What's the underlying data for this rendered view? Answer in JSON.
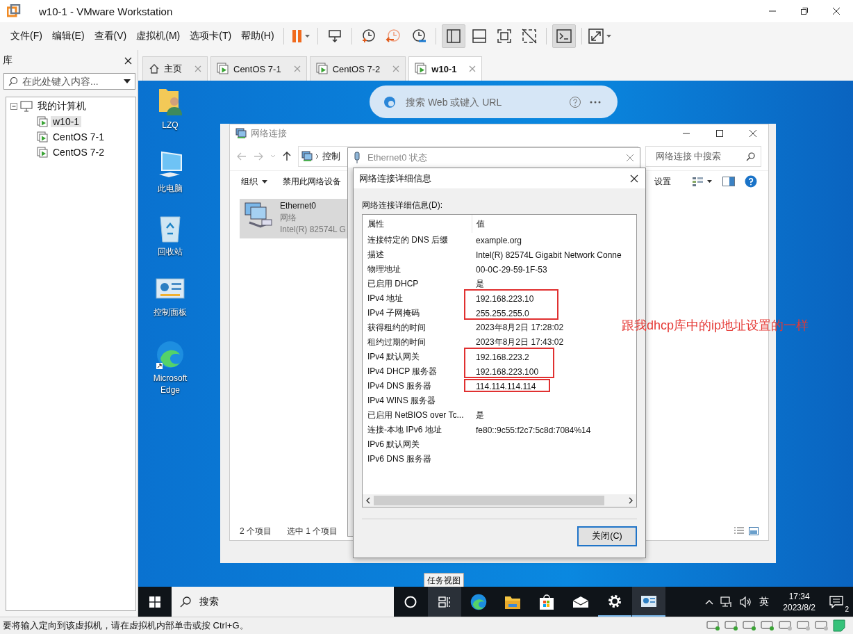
{
  "window": {
    "title": "w10-1 - VMware Workstation"
  },
  "menu": [
    "文件(F)",
    "编辑(E)",
    "查看(V)",
    "虚拟机(M)",
    "选项卡(T)",
    "帮助(H)"
  ],
  "toolbar": [
    {
      "kind": "pause",
      "pressed": false
    },
    {
      "kind": "send-keys",
      "pressed": false
    },
    {
      "kind": "snapshot-take",
      "pressed": false
    },
    {
      "kind": "snapshot-revert",
      "pressed": false
    },
    {
      "kind": "snapshot-manage",
      "pressed": false
    },
    {
      "kind": "view-library",
      "pressed": true
    },
    {
      "kind": "view-thumbs",
      "pressed": false
    },
    {
      "kind": "view-full",
      "pressed": false
    },
    {
      "kind": "view-unity",
      "pressed": false
    },
    {
      "kind": "console",
      "pressed": true
    },
    {
      "kind": "stretch",
      "pressed": false
    }
  ],
  "library": {
    "title": "库",
    "search": {
      "placeholder": "在此处键入内容..."
    },
    "tree": [
      {
        "label": "我的计算机",
        "expanded": true,
        "children": [
          {
            "label": "w10-1",
            "selected": true
          },
          {
            "label": "CentOS 7-1",
            "selected": false
          },
          {
            "label": "CentOS 7-2",
            "selected": false
          }
        ]
      }
    ]
  },
  "tabs": [
    {
      "label": "主页",
      "kind": "home",
      "selected": false
    },
    {
      "label": "CentOS 7-1",
      "kind": "vm",
      "selected": false
    },
    {
      "label": "CentOS 7-2",
      "kind": "vm",
      "selected": false
    },
    {
      "label": "w10-1",
      "kind": "vm",
      "selected": true
    }
  ],
  "desktop": {
    "icons": [
      {
        "label": "LZQ",
        "kind": "user"
      },
      {
        "label": "此电脑",
        "kind": "computer"
      },
      {
        "label": "回收站",
        "kind": "recycle"
      },
      {
        "label": "控制面板",
        "kind": "control"
      },
      {
        "label": "Microsoft Edge",
        "kind": "edge"
      }
    ],
    "edge_bar": {
      "placeholder": "搜索 Web 或键入 URL"
    },
    "annotation": "跟我dhcp库中的ip地址设置的一样",
    "tooltip": "任务视图"
  },
  "explorer": {
    "title": "网络连接",
    "address": "控制",
    "search_placeholder": "网络连接 中搜索",
    "commands": [
      {
        "label": "组织",
        "dropdown": true
      },
      {
        "label": "禁用此网络设备",
        "dropdown": false
      },
      {
        "label": "设置",
        "dropdown": false
      }
    ],
    "item": {
      "name": "Ethernet0",
      "lines": [
        "网络",
        "Intel(R) 82574L G"
      ],
      "selected": true
    },
    "status": [
      "2 个项目",
      "选中 1 个项目"
    ]
  },
  "status_dialog": {
    "title": "Ethernet0 状态"
  },
  "details_dialog": {
    "title": "网络连接详细信息",
    "label": "网络连接详细信息(D):",
    "columns": [
      "属性",
      "值"
    ],
    "row_groups": [
      {
        "boxed": false,
        "rows": [
          {
            "property": "连接特定的 DNS 后缀",
            "value": "example.org"
          },
          {
            "property": "描述",
            "value": "Intel(R) 82574L Gigabit Network Conne"
          },
          {
            "property": "物理地址",
            "value": "00-0C-29-59-1F-53"
          },
          {
            "property": "已启用 DHCP",
            "value": "是"
          }
        ]
      },
      {
        "boxed": true,
        "rows": [
          {
            "property": "IPv4 地址",
            "value": "192.168.223.10"
          },
          {
            "property": "IPv4 子网掩码",
            "value": "255.255.255.0"
          }
        ]
      },
      {
        "boxed": false,
        "rows": [
          {
            "property": "获得租约的时间",
            "value": "2023年8月2日 17:28:02"
          },
          {
            "property": "租约过期的时间",
            "value": "2023年8月2日 17:43:02"
          }
        ]
      },
      {
        "boxed": true,
        "rows": [
          {
            "property": "IPv4 默认网关",
            "value": "192.168.223.2"
          },
          {
            "property": "IPv4 DHCP 服务器",
            "value": "192.168.223.100"
          }
        ]
      },
      {
        "boxed": true,
        "rows": [
          {
            "property": "IPv4 DNS 服务器",
            "value": "114.114.114.114"
          }
        ]
      },
      {
        "boxed": false,
        "rows": [
          {
            "property": "IPv4 WINS 服务器",
            "value": ""
          },
          {
            "property": "已启用 NetBIOS over Tc...",
            "value": "是"
          },
          {
            "property": "连接-本地 IPv6 地址",
            "value": "fe80::9c55:f2c7:5c8d:7084%14"
          },
          {
            "property": "IPv6 默认网关",
            "value": ""
          },
          {
            "property": "IPv6 DNS 服务器",
            "value": ""
          }
        ]
      }
    ],
    "button": "关闭(C)"
  },
  "taskbar": {
    "search": "搜索",
    "apps": [
      {
        "kind": "cortana",
        "running": false,
        "hovered": false
      },
      {
        "kind": "task-view",
        "running": false,
        "hovered": true
      },
      {
        "kind": "edge",
        "running": false,
        "hovered": false
      },
      {
        "kind": "folder",
        "running": false,
        "hovered": false
      },
      {
        "kind": "store",
        "running": false,
        "hovered": false
      },
      {
        "kind": "mail",
        "running": false,
        "hovered": false
      },
      {
        "kind": "settings",
        "running": true,
        "hovered": false
      },
      {
        "kind": "control",
        "running": true,
        "hovered": true
      }
    ],
    "ime": "英",
    "time": "17:34",
    "date": "2023/8/2",
    "notifications": "2"
  },
  "status_bar": "要将输入定向到该虚拟机，请在虚拟机内部单击或按 Ctrl+G。"
}
